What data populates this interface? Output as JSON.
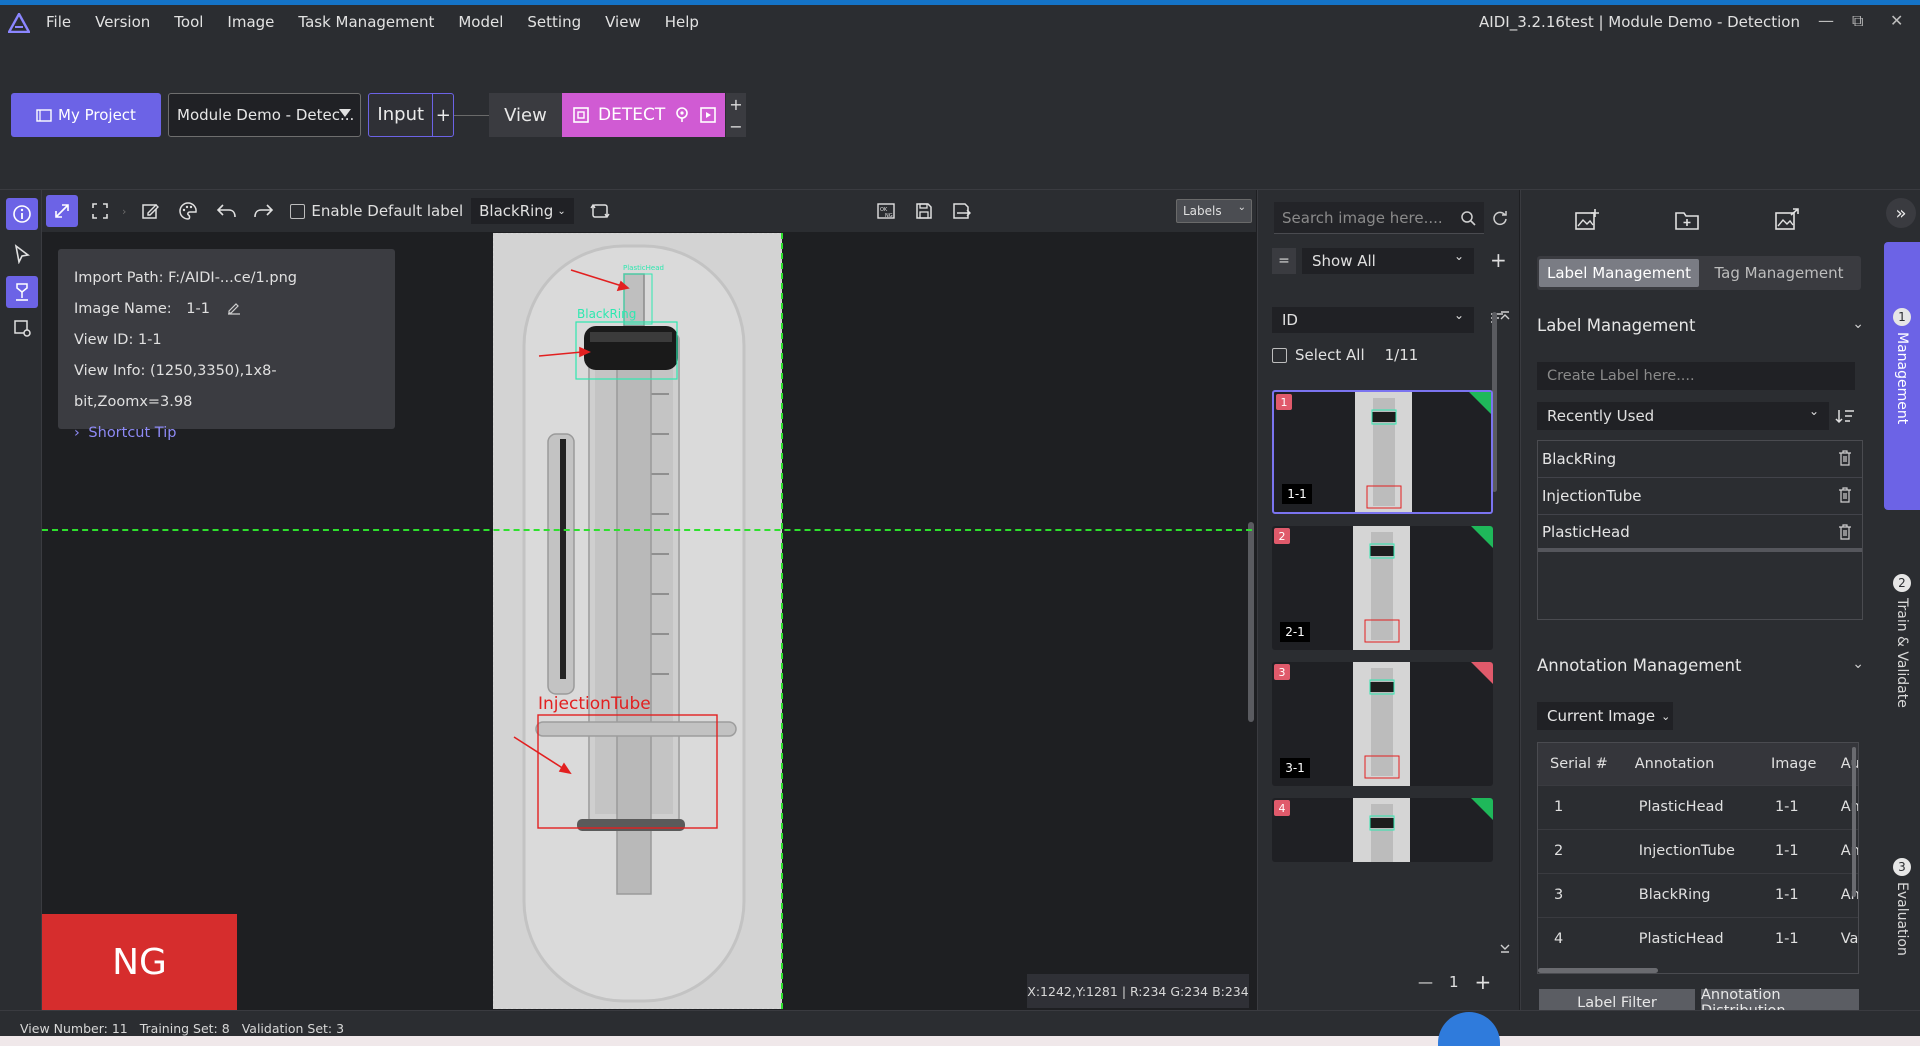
{
  "menubar": {
    "items": [
      "File",
      "Version",
      "Tool",
      "Image",
      "Task Management",
      "Model",
      "Setting",
      "View",
      "Help"
    ],
    "window_title": "AIDI_3.2.16test | Module Demo - Detection",
    "controls": [
      "—",
      "⧉",
      "✕"
    ]
  },
  "flow": {
    "my_project": "My Project",
    "project_select": "Module Demo - Detec...",
    "input_label": "Input",
    "input_plus": "+",
    "view_label": "View",
    "detect_label": "DETECT",
    "add_plus": "+",
    "add_minus": "−"
  },
  "toolbar": {
    "enable_default_label": "Enable Default label",
    "default_label_value": "BlackRing",
    "labels_select": "Labels"
  },
  "info": {
    "import_path": "Import Path: F:/AIDI-...ce/1.png",
    "image_name_label": "Image Name:",
    "image_name_value": "1-1",
    "view_id": "View ID: 1-1",
    "view_info": "View Info: (1250,3350),1x8-bit,Zoomx=3.98",
    "shortcut_tip": "Shortcut Tip"
  },
  "canvas": {
    "annotations": [
      {
        "label": "PlasticHead",
        "color": "#2ee8b0"
      },
      {
        "label": "BlackRing",
        "color": "#2ee8b0"
      },
      {
        "label": "InjectionTube",
        "color": "#e22020"
      }
    ],
    "result_badge": "NG",
    "pixel_readout": "X:1242,Y:1281 | R:234 G:234 B:234"
  },
  "image_list": {
    "search_placeholder": "Search image here....",
    "filter_eq": "=",
    "filter_value": "Show All",
    "sort_value": "ID",
    "select_all": "Select All",
    "count": "1/11",
    "thumbs": [
      {
        "num": "1",
        "id": "1-1",
        "corner": "#1fb85a"
      },
      {
        "num": "2",
        "id": "2-1",
        "corner": "#1fb85a"
      },
      {
        "num": "3",
        "id": "3-1",
        "corner": "#e05a6b"
      },
      {
        "num": "4",
        "id": "",
        "corner": "#1fb85a"
      }
    ],
    "page": "1",
    "minus": "—",
    "plus": "+"
  },
  "right_panel": {
    "tabs": [
      "Label Management",
      "Tag Management"
    ],
    "label_section_title": "Label Management",
    "create_label_placeholder": "Create Label here....",
    "recent_select": "Recently Used",
    "labels": [
      "BlackRing",
      "InjectionTube",
      "PlasticHead"
    ],
    "annotation_section_title": "Annotation Management",
    "scope_select": "Current Image",
    "table": {
      "headers": [
        "Serial #",
        "Annotation",
        "Image",
        "Authoriz"
      ],
      "rows": [
        [
          "1",
          "PlasticHead",
          "1-1",
          "Annotat"
        ],
        [
          "2",
          "InjectionTube",
          "1-1",
          "Annotat"
        ],
        [
          "3",
          "BlackRing",
          "1-1",
          "Annotat"
        ],
        [
          "4",
          "PlasticHead",
          "1-1",
          "Validatic"
        ]
      ]
    },
    "label_filter": "Label Filter",
    "annotation_distribution": "Annotation Distribution"
  },
  "steps": [
    {
      "num": "1",
      "label": "Management"
    },
    {
      "num": "2",
      "label": "Train & Validate"
    },
    {
      "num": "3",
      "label": "Evaluation"
    }
  ],
  "status": {
    "view_number": "View Number: 11",
    "training_set": "Training Set: 8",
    "validation_set": "Validation Set: 3"
  }
}
